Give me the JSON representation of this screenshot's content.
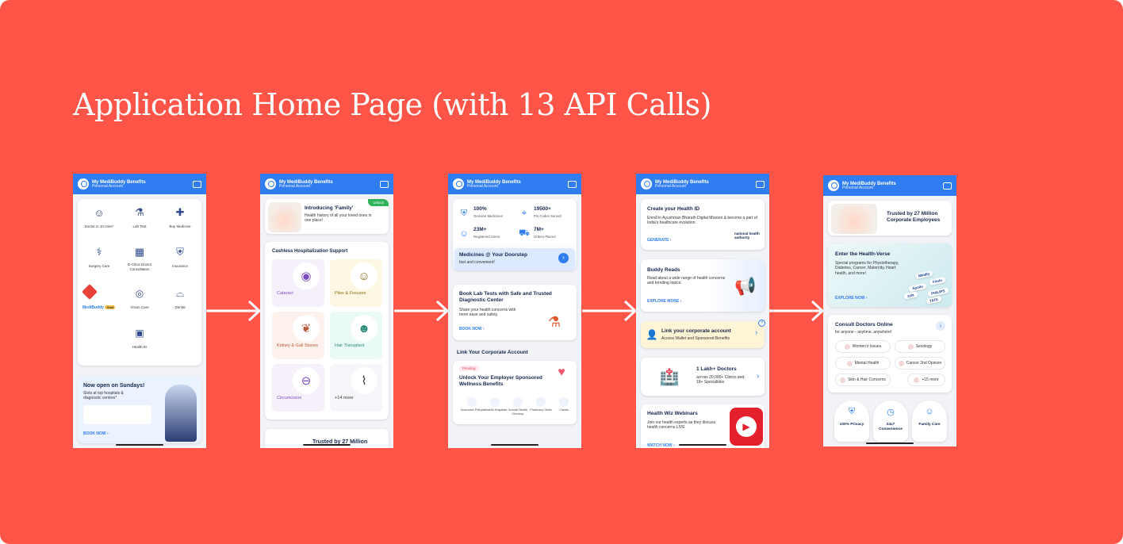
{
  "title": "Application Home Page (with 13 API Calls)",
  "header": {
    "title": "My MediBuddy Benefits",
    "subtitle": "Personal Account"
  },
  "s1": {
    "services": [
      {
        "label": "Doctor in 10 mins*",
        "icon": "doctor-icon"
      },
      {
        "label": "Lab Test",
        "icon": "microscope-icon"
      },
      {
        "label": "Buy Medicine",
        "icon": "medicine-icon"
      },
      {
        "label": "Surgery Care",
        "icon": "surgeon-icon"
      },
      {
        "label": "In-Clinic Doctor Consultation",
        "icon": "clinic-icon"
      },
      {
        "label": "Insurance",
        "icon": "shield-icon"
      },
      {
        "label": "MediBuddy",
        "icon": "medibuddy-gold-logo",
        "badge": "Gold"
      },
      {
        "label": "Vision Care",
        "icon": "glasses-icon"
      },
      {
        "label": "Dental",
        "icon": "tooth-icon"
      },
      {
        "label": "Health ID",
        "icon": "id-card-icon"
      }
    ],
    "promo": {
      "title": "Now open on Sundays!",
      "text": "Slots at top hospitals & diagnostic centres*",
      "cta": "BOOK NOW"
    }
  },
  "s2": {
    "family": {
      "title": "Introducing 'Family'",
      "text": "Health history of all your loved ones in one place!",
      "badge": "Unlock"
    },
    "cashless": {
      "title": "Cashless Hospitalization Support",
      "items": [
        {
          "label": "Cataract",
          "icon": "eye-icon",
          "bg": "#f6f0fb",
          "fg": "#7b4bbf"
        },
        {
          "label": "Piles & Fissures",
          "icon": "patient-icon",
          "bg": "#fdf8e4",
          "fg": "#8a6d12"
        },
        {
          "label": "Kidney & Gall Stones",
          "icon": "kidney-icon",
          "bg": "#fdf1ec",
          "fg": "#b8573c"
        },
        {
          "label": "Hair Transplant",
          "icon": "head-icon",
          "bg": "#eafaf6",
          "fg": "#2a8a79"
        },
        {
          "label": "Circumcision",
          "icon": "circumcision-icon",
          "bg": "#f6f0fb",
          "fg": "#7b4bbf"
        },
        {
          "label": "+14 more",
          "icon": "more-icon",
          "bg": "#f4f6fa",
          "fg": "#333"
        }
      ]
    },
    "peek": "Trusted by 27 Million"
  },
  "s3": {
    "stats": [
      {
        "value": "100%",
        "label": "Genuine Medicines",
        "icon": "shield-check-icon"
      },
      {
        "value": "19500+",
        "label": "Pin Codes Served",
        "icon": "location-icon"
      },
      {
        "value": "23M+",
        "label": "Registered Users",
        "icon": "users-icon"
      },
      {
        "value": "7M+",
        "label": "Orders Placed",
        "icon": "scooter-icon"
      }
    ],
    "medicines": {
      "title": "Medicines @ Your Doorstep",
      "text": "fast and convenient!"
    },
    "lab": {
      "title": "Book Lab Tests with Safe and Trusted Diagnostic Center",
      "text": "Share your health concerns with more ease and safety.",
      "cta": "BOOK NOW"
    },
    "corporate": {
      "heading": "Link Your Corporate Account",
      "badge": "Pending",
      "title": "Unlock Your Employer Sponsored Wellness Benefits",
      "features": [
        "Insurance Policy",
        "Network Hospitals",
        "Annual Health Checkup",
        "Pharmacy Order",
        "Claims"
      ]
    }
  },
  "s4": {
    "healthid": {
      "title": "Create your Health ID",
      "text": "Enroll in Ayushman Bharath Digital Mission & become a part of India's healthcare evolution.",
      "cta": "GENERATE",
      "logo": "national health authority"
    },
    "reads": {
      "title": "Buddy Reads",
      "text": "Read about a wide range of health concerns and trending topics.",
      "cta": "EXPLORE MORE"
    },
    "link": {
      "title": "Link your corporate account",
      "text": "Access Wallet and Sponsored Benefits"
    },
    "doctors": {
      "title": "1 Lakh+ Doctors",
      "text": "across 20,000+ Clinics and 18+ Specialities"
    },
    "webinars": {
      "title": "Health Wiz Webinars",
      "text": "Join our health experts as they discuss health concerns LIVE",
      "cta": "WATCH NOW"
    }
  },
  "s5": {
    "trusted": "Trusted by 27 Million Corporate Employees",
    "verse": {
      "title": "Enter the Health-Verse",
      "text": "Special programs for Physiotherapy, Diabetes, Cancer, Maternity, Heart health, and more!",
      "cta": "EXPLORE NOW",
      "brands": [
        "Mindly",
        "Fitelo",
        "Apollo",
        "PHILIPS",
        "zyla",
        "TATA"
      ]
    },
    "consult": {
      "title": "Consult Doctors Online",
      "subtitle": "for anyone - anytime, anywhere!",
      "pills": [
        "Women's Issues",
        "Sexology",
        "Mental Health",
        "Cancer 2nd Opinion",
        "Skin & Hair Concerns",
        "+15 more"
      ]
    },
    "features": [
      {
        "label": "100% Privacy",
        "icon": "shield-check-icon"
      },
      {
        "label": "24x7 Convenience",
        "icon": "clock-icon"
      },
      {
        "label": "Family Care",
        "icon": "family-icon"
      }
    ]
  },
  "colors": {
    "background": "#FF5548",
    "header": "#2f7df0",
    "link": "#2f7df0"
  }
}
